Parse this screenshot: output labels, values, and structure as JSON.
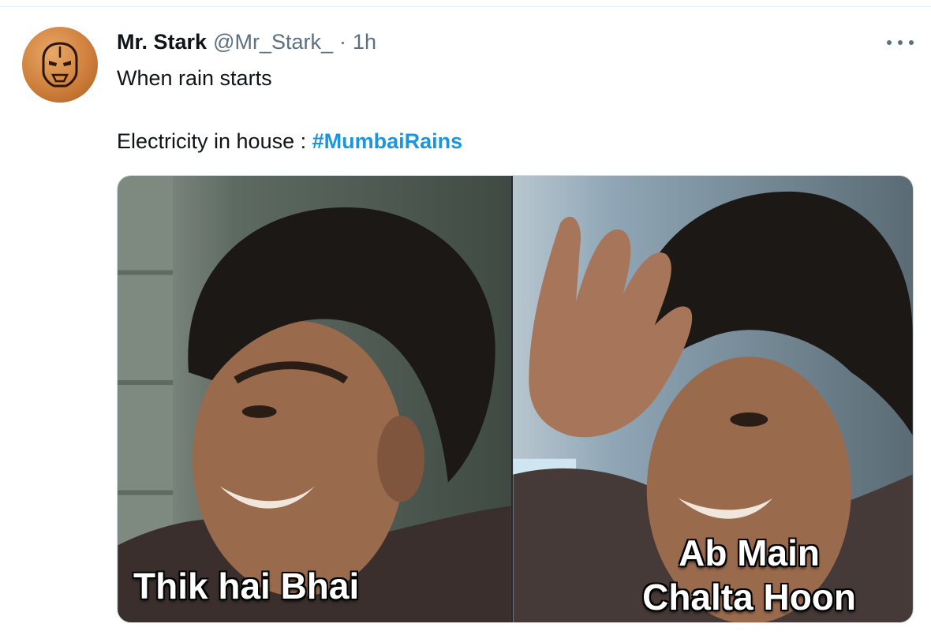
{
  "tweet": {
    "author_name": "Mr. Stark",
    "handle": "@Mr_Stark_",
    "separator": "·",
    "time": "1h",
    "line1": "When rain starts",
    "line2_prefix": "Electricity in house : ",
    "hashtag": "#MumbaiRains"
  },
  "media": {
    "left_caption": "Thik hai Bhai",
    "right_caption_line1": "Ab Main",
    "right_caption_line2": "Chalta Hoon"
  },
  "icons": {
    "avatar": "iron-man-helmet-icon",
    "more": "more-options-icon"
  },
  "colors": {
    "link": "#1b95e0",
    "text": "#0f1419",
    "secondary": "#5b7083",
    "avatar": "#cf7f3c"
  }
}
